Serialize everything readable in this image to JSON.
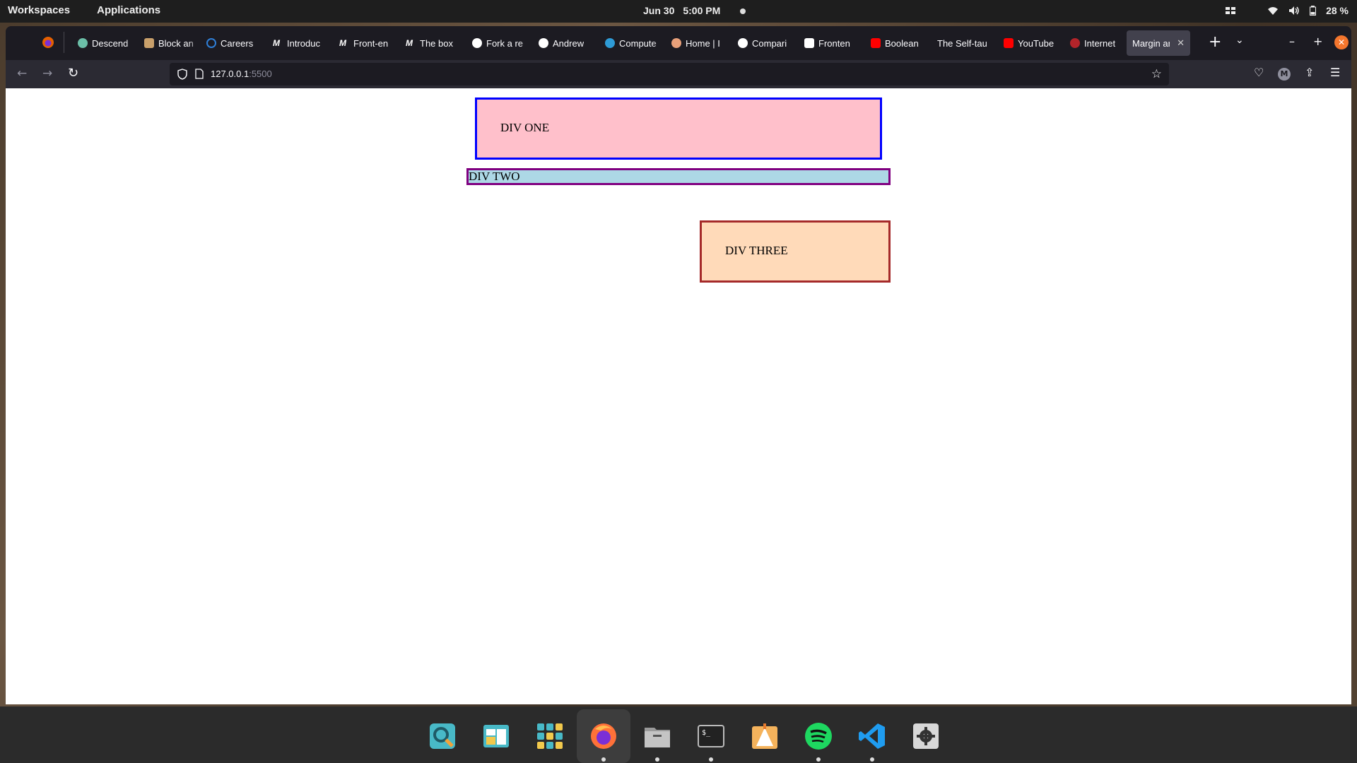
{
  "system_bar": {
    "workspaces": "Workspaces",
    "applications": "Applications",
    "date": "Jun 30",
    "time": "5:00 PM",
    "battery": "28 %"
  },
  "browser": {
    "tabs": [
      {
        "label": "Descend",
        "favicon_color": "#6bbfa8"
      },
      {
        "label": "Block an",
        "favicon_color": "#c9a06b"
      },
      {
        "label": "Careers",
        "favicon_color": "#2f7fd8"
      },
      {
        "label": "Introduc",
        "favicon_color": "#ffffff"
      },
      {
        "label": "Front-en",
        "favicon_color": "#ffffff"
      },
      {
        "label": "The box",
        "favicon_color": "#ffffff"
      },
      {
        "label": "Fork a re",
        "favicon_color": "#ffffff"
      },
      {
        "label": "Andrew",
        "favicon_color": "#ffffff"
      },
      {
        "label": "Compute",
        "favicon_color": "#2e9bd6"
      },
      {
        "label": "Home | I",
        "favicon_color": "#e8a07a"
      },
      {
        "label": "Compari",
        "favicon_color": "#ffffff"
      },
      {
        "label": "Fronten",
        "favicon_color": "#ffffff"
      },
      {
        "label": "Boolean",
        "favicon_color": "#ff0000"
      },
      {
        "label": "The Self-tau",
        "favicon_color": ""
      },
      {
        "label": "YouTube",
        "favicon_color": "#ff0000"
      },
      {
        "label": "Internet",
        "favicon_color": "#b3242a"
      },
      {
        "label": "Margin ar",
        "favicon_color": "",
        "active": true
      }
    ],
    "url_host": "127.0.0.1",
    "url_port": ":5500",
    "account_initial": "M"
  },
  "page": {
    "div_one": "DIV ONE",
    "div_two": "DIV TWO",
    "div_three": "DIV THREE"
  },
  "dock": {
    "apps": [
      "search-app",
      "workspaces-app",
      "app-grid",
      "firefox",
      "files",
      "terminal",
      "installer",
      "spotify",
      "vscode",
      "settings"
    ]
  }
}
